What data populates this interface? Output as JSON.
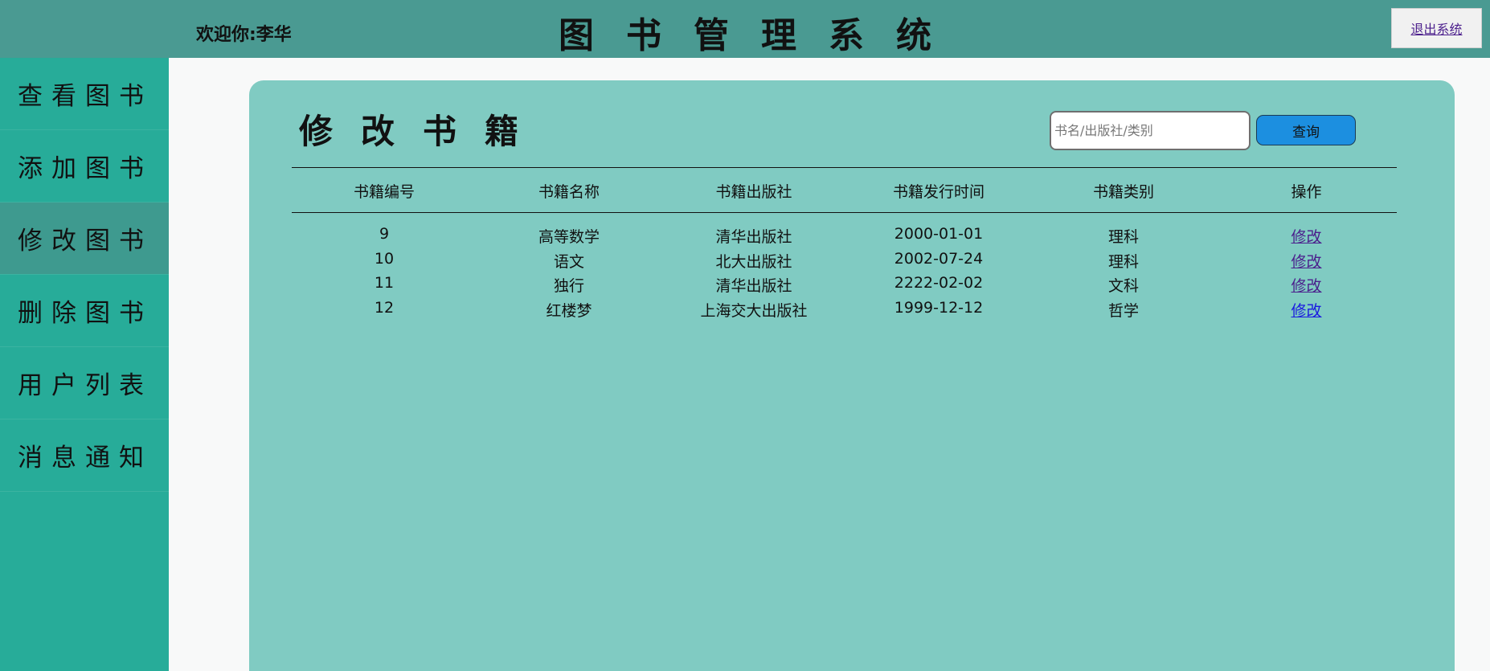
{
  "header": {
    "welcome": "欢迎你:李华",
    "title": "图书管理系统",
    "logout": "退出系统"
  },
  "sidebar": {
    "items": [
      {
        "label": "查看图书"
      },
      {
        "label": "添加图书"
      },
      {
        "label": "修改图书"
      },
      {
        "label": "删除图书"
      },
      {
        "label": "用户列表"
      },
      {
        "label": "消息通知"
      }
    ],
    "active": "修改图书"
  },
  "main": {
    "title": "修改书籍",
    "search": {
      "placeholder": "书名/出版社/类别",
      "value": ""
    },
    "search_button": "查询",
    "table": {
      "columns": [
        "书籍编号",
        "书籍名称",
        "书籍出版社",
        "书籍发行时间",
        "书籍类别",
        "操作"
      ],
      "rows": [
        {
          "id": "9",
          "name": "高等数学",
          "publisher": "清华出版社",
          "date": "2000-01-01",
          "category": "理科",
          "action": "修改"
        },
        {
          "id": "10",
          "name": "语文",
          "publisher": "北大出版社",
          "date": "2002-07-24",
          "category": "理科",
          "action": "修改"
        },
        {
          "id": "11",
          "name": "独行",
          "publisher": "清华出版社",
          "date": "2222-02-02",
          "category": "文科",
          "action": "修改"
        },
        {
          "id": "12",
          "name": "红楼梦",
          "publisher": "上海交大出版社",
          "date": "1999-12-12",
          "category": "哲学",
          "action": "修改"
        }
      ]
    }
  },
  "colors": {
    "topbar": "#4a9a92",
    "sidebar": "#27ac99",
    "sidebar_active": "#3e9a8f",
    "panel": "#80cbc2",
    "search_button": "#1c8fe0"
  }
}
